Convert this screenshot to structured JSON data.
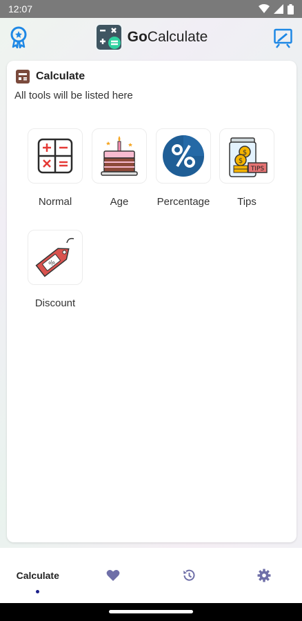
{
  "status_bar": {
    "time": "12:07"
  },
  "app_bar": {
    "brand_bold": "Go",
    "brand_rest": "Calculate"
  },
  "card": {
    "title": "Calculate",
    "subtitle": "All tools will be listed here"
  },
  "tools": [
    {
      "label": "Normal",
      "icon": "calculator-grid-icon"
    },
    {
      "label": "Age",
      "icon": "birthday-cake-icon"
    },
    {
      "label": "Percentage",
      "icon": "percent-badge-icon"
    },
    {
      "label": "Tips",
      "icon": "tip-jar-icon"
    },
    {
      "label": "Discount",
      "icon": "price-tag-icon"
    }
  ],
  "bottom_nav": {
    "items": [
      {
        "label": "Calculate",
        "active": true
      },
      {
        "icon": "heart-icon"
      },
      {
        "icon": "history-icon"
      },
      {
        "icon": "gear-icon"
      }
    ]
  },
  "colors": {
    "accent": "#1e88e5",
    "nav_icon": "#6f6fa8",
    "active_dot": "#1b1f8a"
  }
}
